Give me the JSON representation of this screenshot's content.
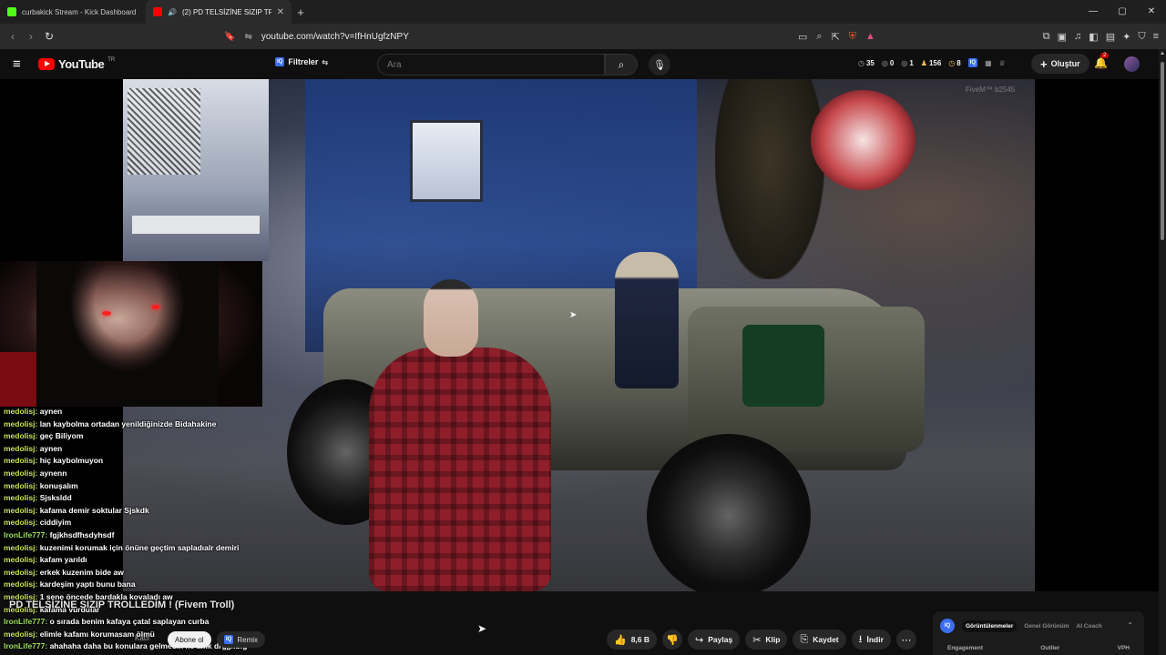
{
  "browser": {
    "tabs": [
      {
        "title": "curbakick Stream - Kick Dashboard",
        "favicon_color": "#53fc18"
      },
      {
        "title": "(2) PD TELSİZİNE SIZIP TROLLEDİM",
        "favicon_color": "#ff0000",
        "audio_icon": "speaker-icon"
      }
    ],
    "new_tab": "+",
    "window_controls": [
      "—",
      "▢",
      "✕"
    ],
    "url": "youtube.com/watch?v=IfHnUgfzNPY"
  },
  "youtube": {
    "logo_text": "YouTube",
    "logo_suffix": "TR",
    "filters_badge": "IQ",
    "filters_label": "Filtreler",
    "search_placeholder": "Ara",
    "stats": [
      {
        "icon": "clock-icon",
        "value": "35"
      },
      {
        "icon": "eye-icon",
        "value": "0"
      },
      {
        "icon": "eye-icon",
        "value": "1"
      },
      {
        "icon": "person-icon",
        "value": "156"
      },
      {
        "icon": "timer-icon",
        "value": "8"
      }
    ],
    "create_label": "Oluştur",
    "notification_count": "2"
  },
  "video": {
    "watermark": "FiveM™ b2545",
    "title": "PD TELSİZİNE SIZIP TROLLEDİM ! (Fivem Troll)"
  },
  "chat": [
    {
      "user": "medolisj:",
      "msg": "aynen"
    },
    {
      "user": "medolisj:",
      "msg": "lan kaybolma ortadan yenildiğinizde Bidahakine"
    },
    {
      "user": "medolisj:",
      "msg": "geç Biliyom"
    },
    {
      "user": "medolisj:",
      "msg": "aynen"
    },
    {
      "user": "medolisj:",
      "msg": "hiç kaybolmuyon"
    },
    {
      "user": "medolisj:",
      "msg": "aynenn"
    },
    {
      "user": "medolisj:",
      "msg": "konuşalım"
    },
    {
      "user": "medolisj:",
      "msg": "Sjsksldd"
    },
    {
      "user": "medolisj:",
      "msg": "kafama demir soktular Sjskdk"
    },
    {
      "user": "medolisj:",
      "msg": "ciddiyim"
    },
    {
      "user": "IronLife777:",
      "msg": "fgjkhsdfhsdyhsdf"
    },
    {
      "user": "medolisj:",
      "msg": "kuzenimi korumak için önüne geçtim sapladıalr demiri"
    },
    {
      "user": "medolisj:",
      "msg": "kafam yarıldı"
    },
    {
      "user": "medolisj:",
      "msg": "erkek kuzenim bide aw"
    },
    {
      "user": "medolisj:",
      "msg": "kardeşim yaptı bunu bana"
    },
    {
      "user": "medolisj:",
      "msg": "1 sene öncede bardakla kovaladı aw"
    },
    {
      "user": "medolisj:",
      "msg": "kafama vurdular"
    },
    {
      "user": "IronLife777:",
      "msg": "o sırada benim kafaya çatal saplayan curba"
    },
    {
      "user": "medolisj:",
      "msg": "elimle kafamı korumasam ölmü"
    },
    {
      "user": "IronLife777:",
      "msg": "ahahaha daha bu konulara gelmedik ne amk drgjjkdfg"
    }
  ],
  "bottom": {
    "katil": "Katıl",
    "subscribe": "Abone ol",
    "remix": "Remix",
    "actions": {
      "like_count": "8,6 B",
      "share": "Paylaş",
      "clip": "Klip",
      "save": "Kaydet",
      "download": "İndir"
    }
  },
  "vidiq_panel": {
    "logo": "IQ",
    "tabs": [
      "Görüntülenmeler",
      "Genel Görünüm",
      "AI Coach"
    ],
    "columns": [
      "Engagement",
      "Outlier",
      "VPH"
    ]
  }
}
